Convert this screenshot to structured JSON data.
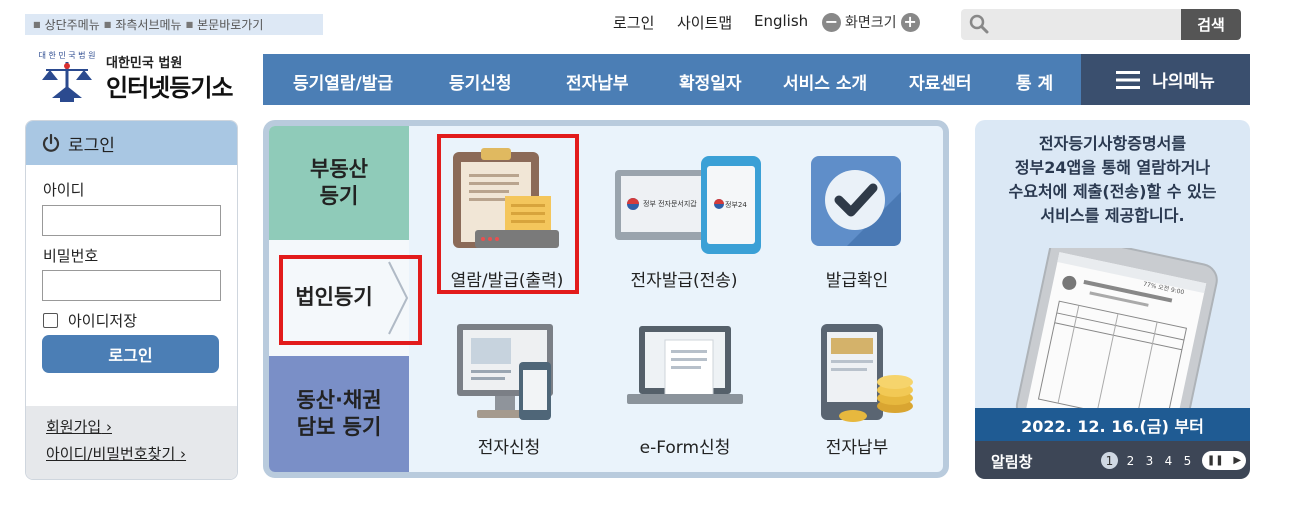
{
  "skip_links": [
    "상단주메뉴",
    "좌측서브메뉴",
    "본문바로가기"
  ],
  "util": {
    "login": "로그인",
    "sitemap": "사이트맵",
    "english": "English",
    "zoom_label": "화면크기",
    "zoom_minus": "−",
    "zoom_plus": "+"
  },
  "search": {
    "placeholder": "",
    "button": "검색"
  },
  "logo": {
    "small": "대한민국 법원",
    "main": "인터넷등기소",
    "seal_text": "대한민국법원"
  },
  "gnb": {
    "items": [
      "등기열람/발급",
      "등기신청",
      "전자납부",
      "확정일자",
      "서비스 소개",
      "자료센터",
      "통 계"
    ],
    "mymenu": "나의메뉴"
  },
  "login": {
    "title": "로그인",
    "id_label": "아이디",
    "pw_label": "비밀번호",
    "remember": "아이디저장",
    "button": "로그인",
    "signup": "회원가입",
    "find": "아이디/비밀번호찾기"
  },
  "categories": {
    "real_estate": [
      "부동산",
      "등기"
    ],
    "corporate": "법인등기",
    "movable": [
      "동산·채권",
      "담보 등기"
    ]
  },
  "services": {
    "view_issue": "열람/발급(출력)",
    "e_issue": "전자발급(전송)",
    "verify": "발급확인",
    "e_apply": "전자신청",
    "eform": "e-Form신청",
    "e_pay": "전자납부",
    "e_issue_tablet_label": "정부24",
    "e_issue_monitor_label": "정부 전자문서지갑"
  },
  "banner": {
    "lines": [
      "전자등기사항증명서를",
      "정부24앱을 통해 열람하거나",
      "수요처에 제출(전송)할 수 있는",
      "서비스를 제공합니다."
    ],
    "date": "2022. 12. 16.(금) 부터",
    "notice": "알림창",
    "pages": [
      "1",
      "2",
      "3",
      "4",
      "5"
    ],
    "current_page": 1,
    "phone_status": "77%  오전 9:00"
  },
  "colors": {
    "gnb": "#4b7eb5",
    "mymenu": "#3a4f6e",
    "highlight": "#e21b1b",
    "cat_real_estate": "#8fcbb9",
    "cat_movable": "#7a8fc7"
  }
}
